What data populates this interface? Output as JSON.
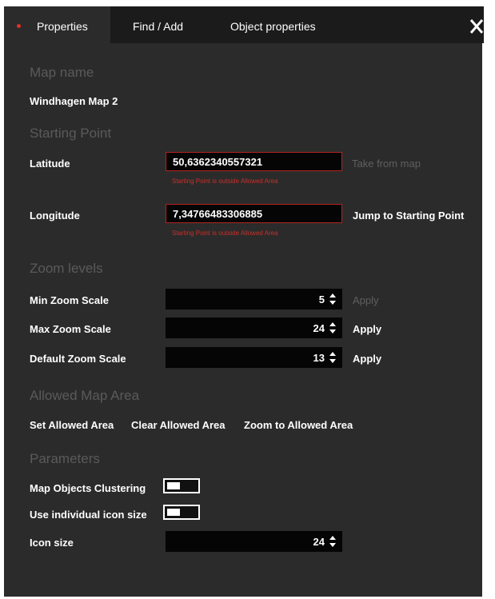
{
  "tabs": [
    {
      "label": "Properties",
      "active": true
    },
    {
      "label": "Find / Add",
      "active": false
    },
    {
      "label": "Object properties",
      "active": false
    }
  ],
  "map_name": {
    "heading": "Map name",
    "value": "Windhagen Map 2"
  },
  "starting_point": {
    "heading": "Starting Point",
    "latitude": {
      "label": "Latitude",
      "value": "50,6362340557321",
      "error": "Starting Point is outside Allowed Area",
      "action": "Take from map"
    },
    "longitude": {
      "label": "Longitude",
      "value": "7,34766483306885",
      "error": "Starting Point is outside Allowed Area",
      "action": "Jump to Starting Point"
    }
  },
  "zoom": {
    "heading": "Zoom levels",
    "min": {
      "label": "Min Zoom Scale",
      "value": "5",
      "apply": "Apply",
      "apply_enabled": false
    },
    "max": {
      "label": "Max Zoom Scale",
      "value": "24",
      "apply": "Apply",
      "apply_enabled": true
    },
    "default": {
      "label": "Default Zoom Scale",
      "value": "13",
      "apply": "Apply",
      "apply_enabled": true
    }
  },
  "allowed_area": {
    "heading": "Allowed Map Area",
    "set": "Set Allowed Area",
    "clear": "Clear Allowed Area",
    "zoom": "Zoom to Allowed Area"
  },
  "parameters": {
    "heading": "Parameters",
    "clustering": {
      "label": "Map Objects Clustering",
      "on": false
    },
    "individual_icon_size": {
      "label": "Use individual icon size",
      "on": false
    },
    "icon_size": {
      "label": "Icon size",
      "value": "24"
    }
  },
  "colors": {
    "panel": "#2b2b2b",
    "tabbar": "#1b1b1b",
    "error": "#c8302a",
    "accent": "#e0302a"
  },
  "icons": {
    "close": "close-icon",
    "stepper": "spinner-arrows-icon"
  }
}
